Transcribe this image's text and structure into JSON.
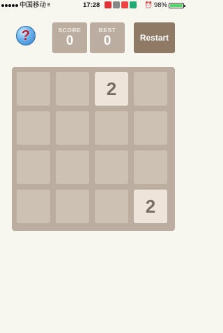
{
  "status_bar": {
    "carrier": "中国移动",
    "network": "E",
    "time": "17:28",
    "battery": "98%",
    "battery_level": 0.98
  },
  "header": {
    "help_icon": "question-mark-icon",
    "score_label": "SCORE",
    "score_value": "0",
    "best_label": "BEST",
    "best_value": "0",
    "restart_label": "Restart"
  },
  "board": {
    "rows": [
      [
        "",
        "",
        "2",
        ""
      ],
      [
        "",
        "",
        "",
        ""
      ],
      [
        "",
        "",
        "",
        ""
      ],
      [
        "",
        "",
        "",
        "2"
      ]
    ]
  },
  "colors": {
    "background": "#f7f6ef",
    "board": "#bbada0",
    "empty_cell": "#cdc1b4",
    "tile_2": "#eee4da",
    "tile_text": "#776e65",
    "restart": "#8f7a66"
  }
}
